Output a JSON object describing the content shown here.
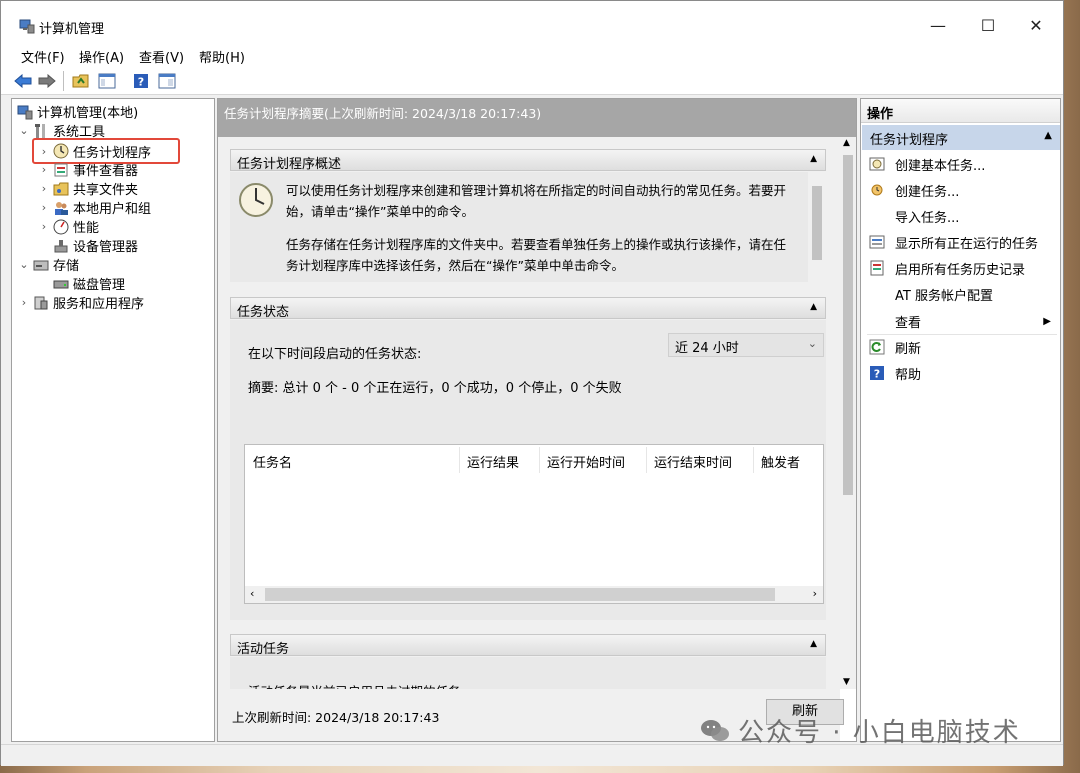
{
  "window": {
    "title": "计算机管理",
    "buttons": {
      "minimize": "—",
      "maximize": "☐",
      "close": "✕"
    }
  },
  "menu": [
    "文件(F)",
    "操作(A)",
    "查看(V)",
    "帮助(H)"
  ],
  "toolbar": [
    "back-arrow-icon",
    "forward-arrow-icon",
    "up-folder-icon",
    "show-hide-tree-icon",
    "help-icon",
    "properties-icon"
  ],
  "tree": {
    "root": "计算机管理(本地)",
    "system_tools": "系统工具",
    "task_scheduler": "任务计划程序",
    "event_viewer": "事件查看器",
    "shared_folders": "共享文件夹",
    "local_users": "本地用户和组",
    "performance": "性能",
    "device_manager": "设备管理器",
    "storage": "存储",
    "disk_management": "磁盘管理",
    "services": "服务和应用程序"
  },
  "middle": {
    "header": "任务计划程序摘要(上次刷新时间: 2024/3/18 20:17:43)",
    "overview": {
      "title": "任务计划程序概述",
      "p1": "可以使用任务计划程序来创建和管理计算机将在所指定的时间自动执行的常见任务。若要开始，请单击“操作”菜单中的命令。",
      "p2": "任务存储在任务计划程序库的文件夹中。若要查看单独任务上的操作或执行该操作，请在任务计划程序库中选择该任务，然后在“操作”菜单中单击命令。"
    },
    "status": {
      "title": "任务状态",
      "range_label": "在以下时间段启动的任务状态:",
      "range_value": "近 24 小时",
      "summary": "摘要: 总计 0 个 - 0 个正在运行，0 个成功，0 个停止，0 个失败",
      "columns": [
        "任务名",
        "运行结果",
        "运行开始时间",
        "运行结束时间",
        "触发者"
      ]
    },
    "active": {
      "title": "活动任务",
      "text": "活动任务是当前已启用且未过期的任务。"
    },
    "last_refresh": "上次刷新时间: 2024/3/18 20:17:43",
    "refresh_button": "刷新"
  },
  "actions": {
    "title": "操作",
    "group": "任务计划程序",
    "items": [
      {
        "label": "创建基本任务...",
        "icon": "create-basic-task-icon"
      },
      {
        "label": "创建任务...",
        "icon": "create-task-icon"
      },
      {
        "label": "导入任务...",
        "icon": ""
      },
      {
        "label": "显示所有正在运行的任务",
        "icon": "running-tasks-icon"
      },
      {
        "label": "启用所有任务历史记录",
        "icon": "history-icon"
      },
      {
        "label": "AT 服务帐户配置",
        "icon": ""
      },
      {
        "label": "查看",
        "icon": ""
      },
      {
        "label": "刷新",
        "icon": "refresh-icon"
      },
      {
        "label": "帮助",
        "icon": "help-icon"
      }
    ]
  },
  "watermark": "公众号 · 小白电脑技术"
}
